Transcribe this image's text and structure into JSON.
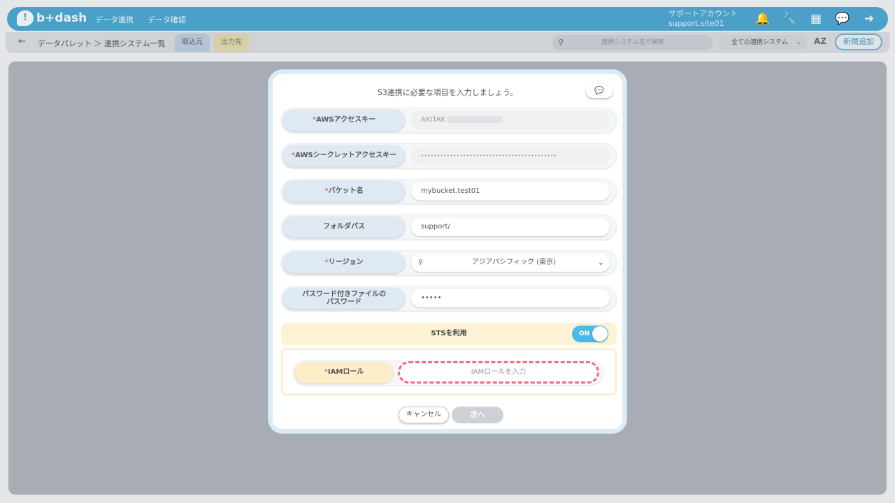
{
  "header": {
    "logo_text": "b+dash",
    "nav": [
      "データ連携",
      "データ確認"
    ],
    "account_line1": "サポートアカウント",
    "account_line2": "support.site01",
    "icons": [
      "bell-icon",
      "wrench-icon",
      "grid-icon",
      "chat-icon",
      "logout-icon"
    ]
  },
  "subbar": {
    "back": "←",
    "breadcrumb": "データパレット ＞ 連携システム一覧",
    "tab_source": "取込元",
    "tab_dest": "出力先",
    "search_placeholder": "連携システム名で検索",
    "filter_value": "全ての連携システム",
    "sort_label": "AZ",
    "add_new": "新規追加"
  },
  "modal": {
    "title": "S3連携に必要な項目を入力しましょう。",
    "help_icon": "chat-help-icon",
    "fields": [
      {
        "label": "AWSアクセスキー",
        "required": true,
        "value": "AKITAK"
      },
      {
        "label": "AWSシークレットアクセスキー",
        "required": true,
        "value": "••••••••••••••••••••••••••••••••••••••••••"
      },
      {
        "label": "バケット名",
        "required": true,
        "value": "mybucket.test01"
      },
      {
        "label": "フォルダパス",
        "required": false,
        "value": "support/"
      },
      {
        "label": "リージョン",
        "required": true,
        "value": "アジアパシフィック (東京)"
      },
      {
        "label_line1": "パスワード付きファイルの",
        "label_line2": "パスワード",
        "required": false,
        "value": "•••••"
      }
    ],
    "sts_label": "STSを利用",
    "sts_toggle": "ON",
    "iam_label": "IAMロール",
    "iam_placeholder": "IAMロールを入力",
    "cancel": "キャンセル",
    "next": "次へ"
  }
}
